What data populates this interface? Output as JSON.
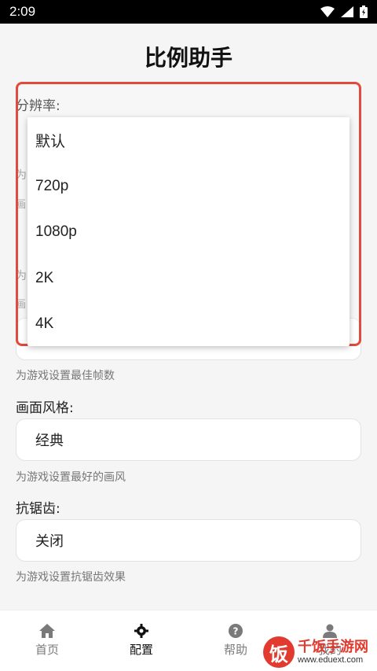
{
  "status_bar": {
    "time": "2:09"
  },
  "page": {
    "title": "比例助手"
  },
  "fields": {
    "resolution": {
      "label": "分辨率:"
    },
    "hidden_hint_1": "为",
    "hidden_hint_2": "为",
    "hidden_box_1": "画",
    "hidden_box_2": "画",
    "fps": {
      "hint": "为游戏设置最佳帧数"
    },
    "style": {
      "label": "画面风格:",
      "value": "经典",
      "hint": "为游戏设置最好的画风"
    },
    "antialias": {
      "label": "抗锯齿:",
      "value": "关闭",
      "hint": "为游戏设置抗锯齿效果"
    }
  },
  "dropdown": {
    "options": [
      "默认",
      "720p",
      "1080p",
      "2K",
      "4K"
    ],
    "highlight_color": "#e24a3c"
  },
  "bottom_nav": [
    {
      "label": "首页",
      "icon": "home-icon",
      "active": false
    },
    {
      "label": "配置",
      "icon": "gear-icon",
      "active": true
    },
    {
      "label": "帮助",
      "icon": "help-icon",
      "active": false
    },
    {
      "label": "我的",
      "icon": "user-icon",
      "active": false
    }
  ],
  "watermark": {
    "logo": "饭",
    "title": "千饭手游网",
    "url": "www.eduext.com"
  }
}
